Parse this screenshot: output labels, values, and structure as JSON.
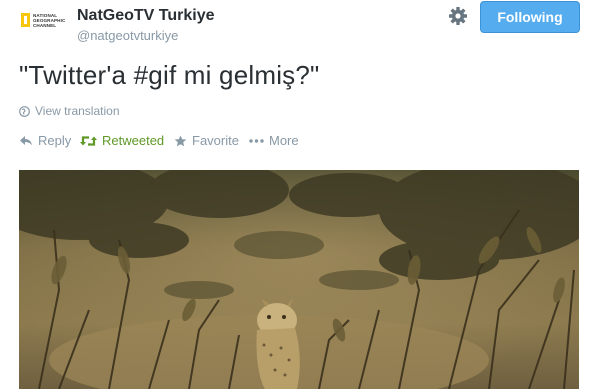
{
  "header": {
    "avatar_text": "NATIONAL GEOGRAPHIC CHANNEL",
    "display_name": "NatGeoTV Turkiye",
    "handle": "@natgeotvturkiye",
    "follow_label": "Following",
    "gear_icon": "gear-icon"
  },
  "tweet": {
    "text": "\"Twitter'a #gif mi gelmiş?\"",
    "translate_label": "View translation"
  },
  "actions": {
    "reply": "Reply",
    "retweeted": "Retweeted",
    "favorite": "Favorite",
    "more": "More"
  },
  "colors": {
    "follow_button": "#55acee",
    "retweeted": "#609928",
    "muted": "#8899a6"
  }
}
